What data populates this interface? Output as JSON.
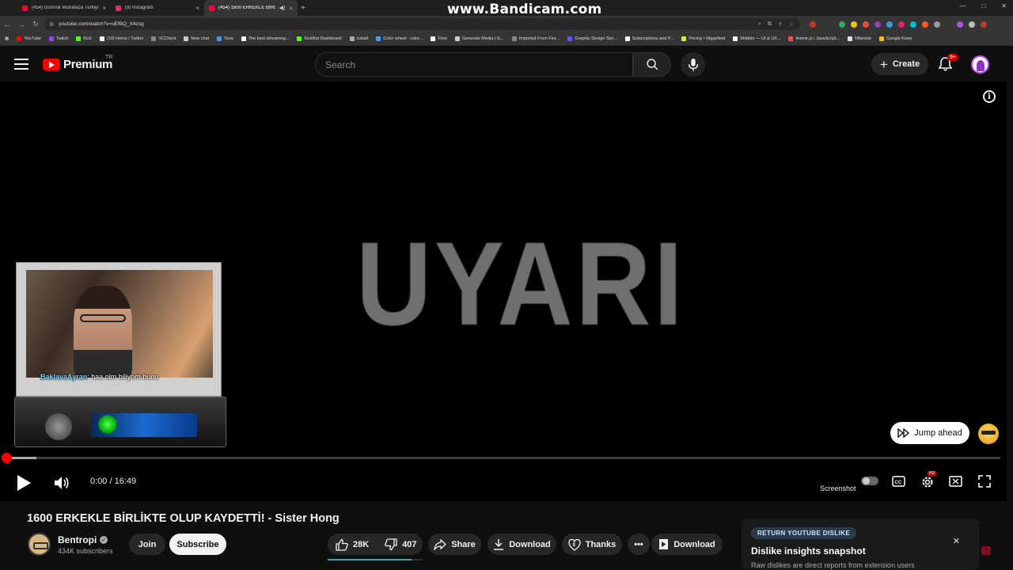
{
  "browser": {
    "tabs": [
      {
        "title": "(454) Gümrük Muhafaza Türkiye",
        "color": "#ff0033",
        "active": false
      },
      {
        "title": "(9) Instagram",
        "color": "#e1306c",
        "active": false
      },
      {
        "title": "(454) 1600 ERKEKLE BİRLİ",
        "color": "#ff0033",
        "active": true
      }
    ],
    "watermark": "www.Bandicam.com",
    "url": "youtube.com/watch?v=oEfBQ_X4zsg",
    "bookmarks": [
      {
        "label": "YouTube",
        "color": "#ff0000"
      },
      {
        "label": "Twitch",
        "color": "#9146ff"
      },
      {
        "label": "Kick",
        "color": "#53fc18"
      },
      {
        "label": "(10) Home / Twitter",
        "color": "#ffffff"
      },
      {
        "label": "VCClient",
        "color": "#888888"
      },
      {
        "label": "New chat",
        "color": "#cccccc"
      },
      {
        "label": "Sora",
        "color": "#4a90e2"
      },
      {
        "label": "The best streaming...",
        "color": "#ffffff"
      },
      {
        "label": "KickBot Dashboard",
        "color": "#53fc18"
      },
      {
        "label": "cobalt",
        "color": "#aaaaaa"
      },
      {
        "label": "Color wheel - color...",
        "color": "#3aa0ff"
      },
      {
        "label": "Flow",
        "color": "#ffffff"
      },
      {
        "label": "Generate Media | G...",
        "color": "#cccccc"
      },
      {
        "label": "Imported From Fire...",
        "color": "#888888"
      },
      {
        "label": "Graphic Design Styl...",
        "color": "#5b5bff"
      },
      {
        "label": "Subscriptions and P...",
        "color": "#ffffff"
      },
      {
        "label": "Pricing • Higgsfield",
        "color": "#c6f432"
      },
      {
        "label": "Mobbin — UI & UX...",
        "color": "#ffffff"
      },
      {
        "label": "Anime.js | JavaScript...",
        "color": "#ff4b4b"
      },
      {
        "label": "Milanote",
        "color": "#dddddd"
      },
      {
        "label": "Google Keep",
        "color": "#fbbc04"
      }
    ]
  },
  "header": {
    "logo_text": "Premium",
    "country": "TR",
    "search_placeholder": "Search",
    "create_label": "Create",
    "notif_count": "9+"
  },
  "player": {
    "frame_text": "UYARI",
    "chat_user": "BaklavaAyran",
    "chat_text": ": haa olm biliyom bunu",
    "jump_label": "Jump ahead",
    "time": "0:00 / 16:49",
    "progress": 0,
    "buffered": 0.03,
    "screenshot_label": "Screenshot"
  },
  "video": {
    "title": "1600 ERKEKLE BİRLİKTE OLUP KAYDETTİ! - Sister Hong",
    "channel": "Bentropi",
    "subscribers": "434K subscribers",
    "join_label": "Join",
    "subscribe_label": "Subscribe",
    "likes": "28K",
    "dislikes": "407",
    "like_ratio": 0.88,
    "share_label": "Share",
    "download_label": "Download",
    "thanks_label": "Thanks",
    "download2_label": "Download"
  },
  "ryd": {
    "tag": "RETURN YOUTUBE DISLIKE",
    "title": "Dislike insights snapshot",
    "subtitle": "Raw dislikes are direct reports from extension users"
  }
}
